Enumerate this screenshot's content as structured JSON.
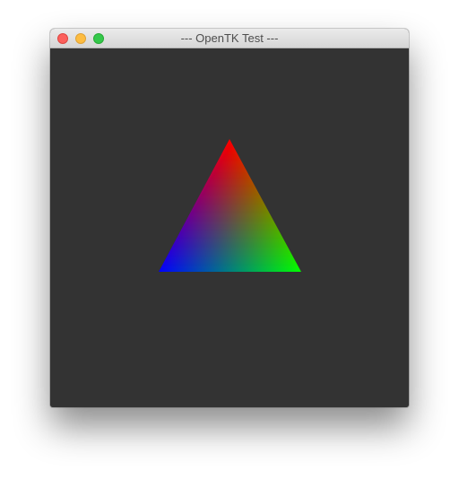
{
  "window": {
    "title": "--- OpenTK Test ---",
    "clear_color": "#333333"
  },
  "titlebar": {
    "buttons": [
      {
        "name": "close",
        "color": "#fc605c"
      },
      {
        "name": "minimize",
        "color": "#fdbc40"
      },
      {
        "name": "zoom",
        "color": "#34c84a"
      }
    ]
  },
  "scene": {
    "triangle": {
      "vertex_colors": {
        "top": "#ff0000",
        "bottom_left": "#0000ff",
        "bottom_right": "#00ff00"
      }
    }
  }
}
